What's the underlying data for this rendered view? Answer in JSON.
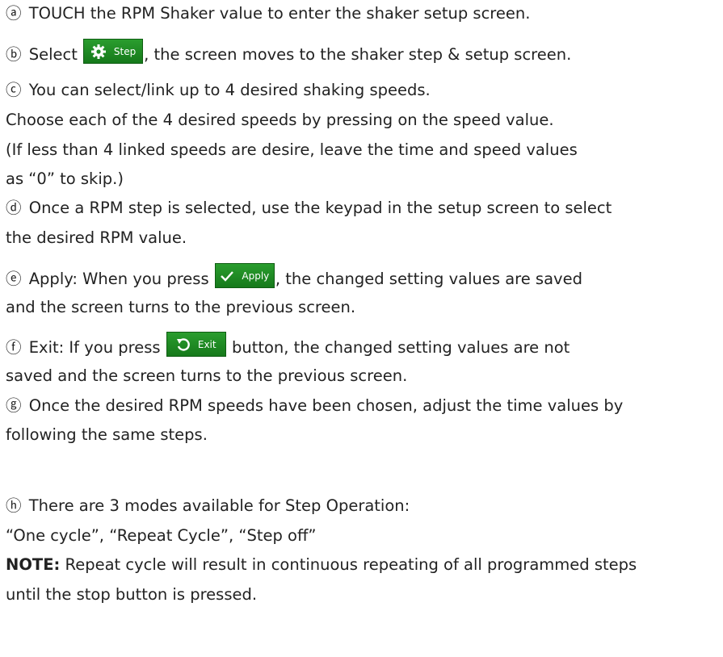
{
  "steps": {
    "a": {
      "marker": "ⓐ",
      "text": "TOUCH the RPM Shaker value to enter the shaker setup screen."
    },
    "b": {
      "marker": "ⓑ",
      "pre": "Select",
      "button_label": "Step",
      "post": ", the screen moves to the shaker step & setup screen."
    },
    "c": {
      "marker": "ⓒ",
      "text": "You can select/link up to 4 desired shaking speeds."
    },
    "c2": "Choose each of the 4 desired speeds by pressing on the speed value.",
    "c3": "(If less than 4 linked speeds are desire, leave the time and speed values",
    "c4": "as “0” to skip.)",
    "d": {
      "marker": "ⓓ",
      "text": "Once a RPM step is selected, use the keypad in the setup screen to select"
    },
    "d2": "the desired RPM value.",
    "e": {
      "marker": "ⓔ",
      "pre": "Apply: When you press",
      "button_label": "Apply",
      "post": ",   the changed setting values are saved"
    },
    "e2": "and the screen turns to the previous screen.",
    "f": {
      "marker": "ⓕ",
      "pre": "Exit: If you press",
      "button_label": "Exit",
      "post": "button, the changed setting values are not"
    },
    "f2": "saved and the screen turns to the previous screen.",
    "g": {
      "marker": "ⓖ",
      "text": "Once the desired RPM speeds have been chosen, adjust the time values by"
    },
    "g2": "following the same steps.",
    "h": {
      "marker": "ⓗ",
      "text": "There are 3 modes available for Step Operation:"
    },
    "h2": "“One cycle”, “Repeat Cycle”, “Step off”",
    "note": {
      "label": "NOTE:",
      "text": "Repeat cycle will result in continuous repeating of all programmed steps"
    },
    "note2": "until the stop button is pressed."
  },
  "colors": {
    "button_green": "#1f8c24",
    "text": "#222222"
  },
  "icons": {
    "step": "gear-icon",
    "apply": "checkmark-icon",
    "exit": "undo-arrow-icon"
  }
}
